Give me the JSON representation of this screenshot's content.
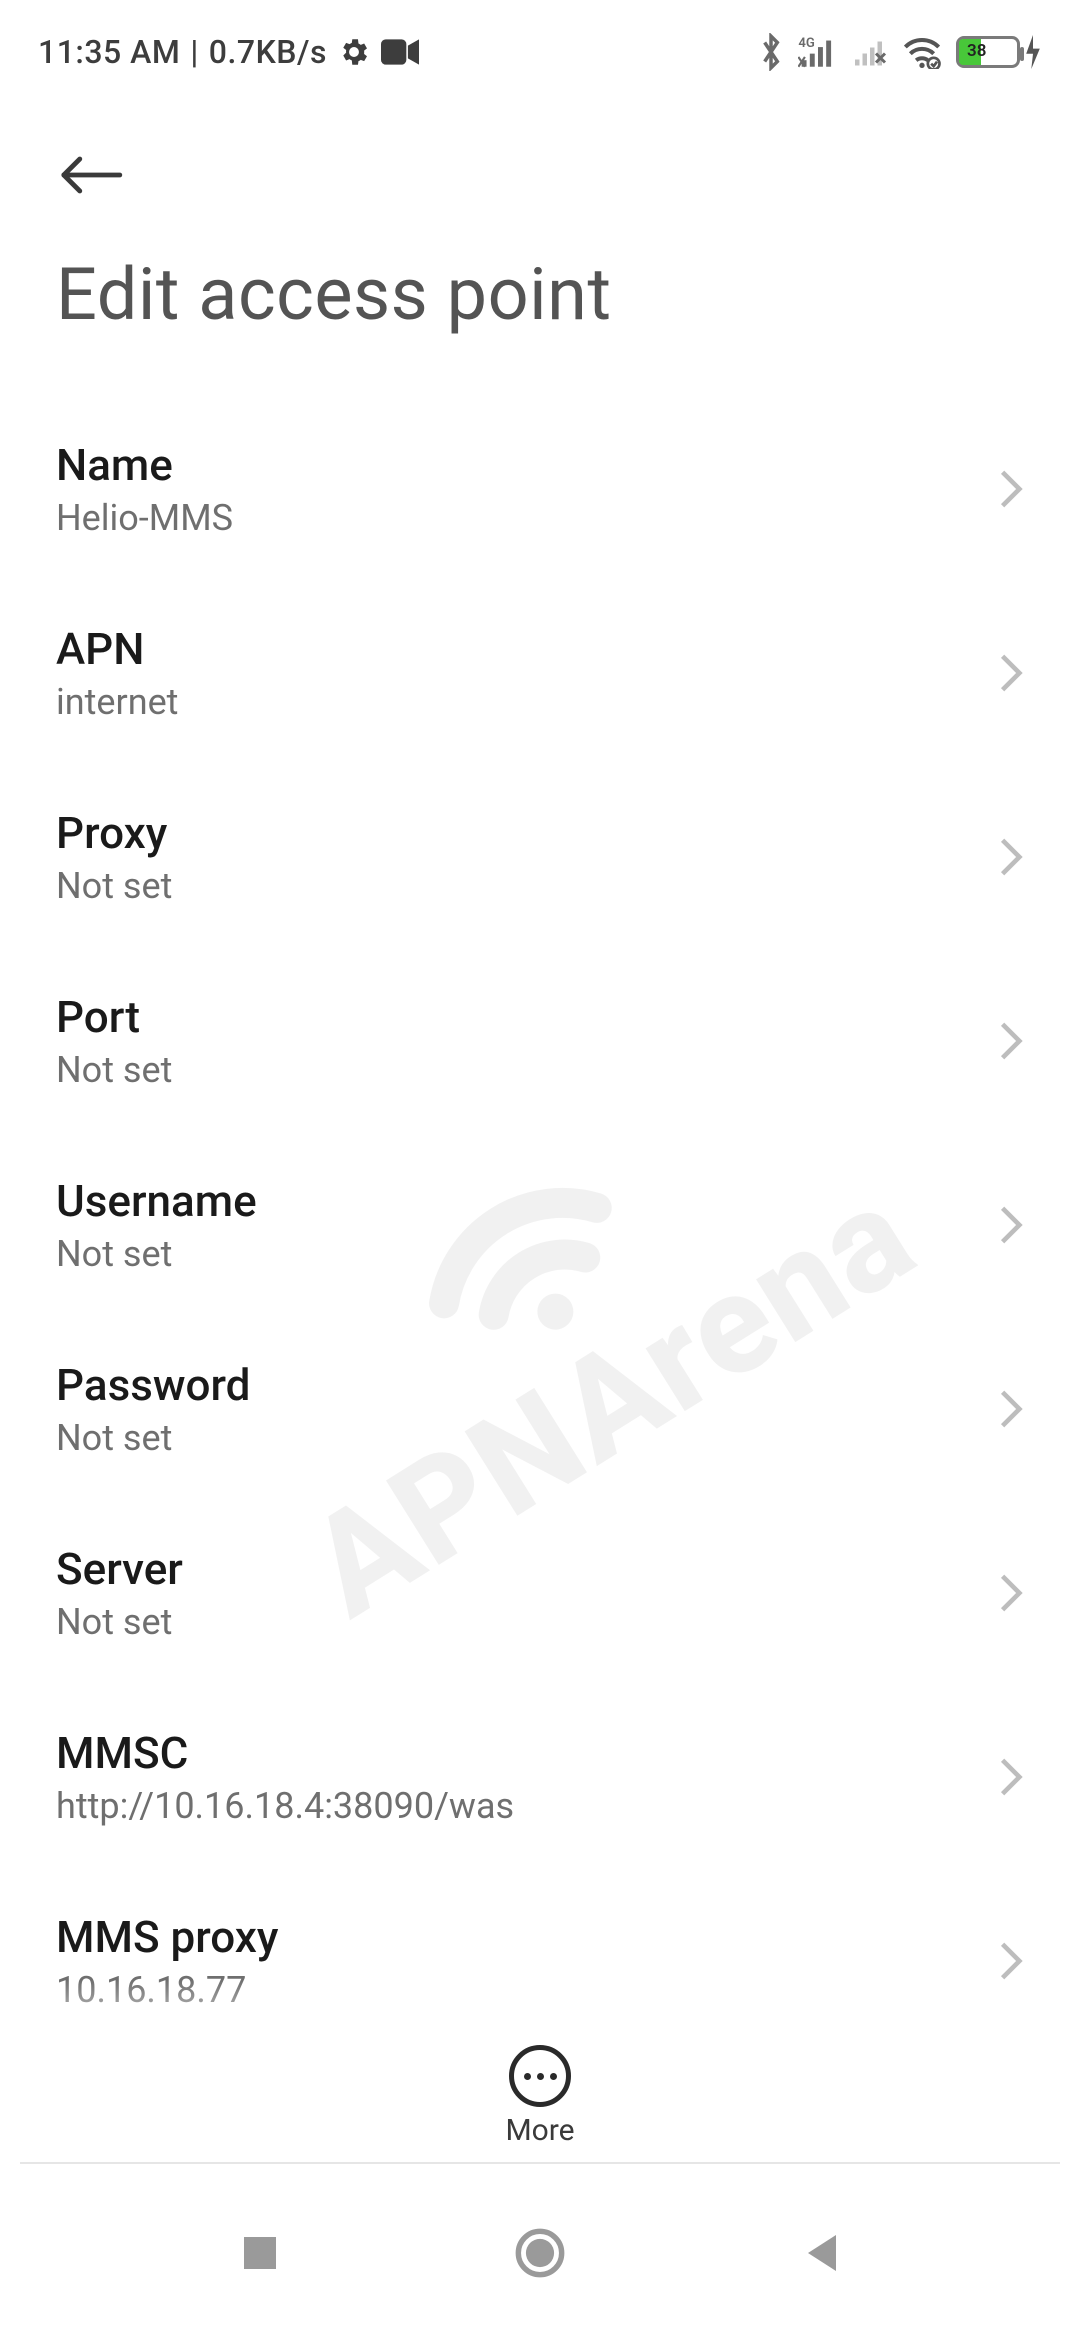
{
  "status": {
    "time": "11:35 AM",
    "rate": "0.7KB/s",
    "battery_percent": "38"
  },
  "page": {
    "title": "Edit access point"
  },
  "fields": [
    {
      "label": "Name",
      "value": "Helio-MMS"
    },
    {
      "label": "APN",
      "value": "internet"
    },
    {
      "label": "Proxy",
      "value": "Not set"
    },
    {
      "label": "Port",
      "value": "Not set"
    },
    {
      "label": "Username",
      "value": "Not set"
    },
    {
      "label": "Password",
      "value": "Not set"
    },
    {
      "label": "Server",
      "value": "Not set"
    },
    {
      "label": "MMSC",
      "value": "http://10.16.18.4:38090/was"
    },
    {
      "label": "MMS proxy",
      "value": "10.16.18.77"
    }
  ],
  "more": {
    "label": "More"
  },
  "watermark": "APNArena"
}
